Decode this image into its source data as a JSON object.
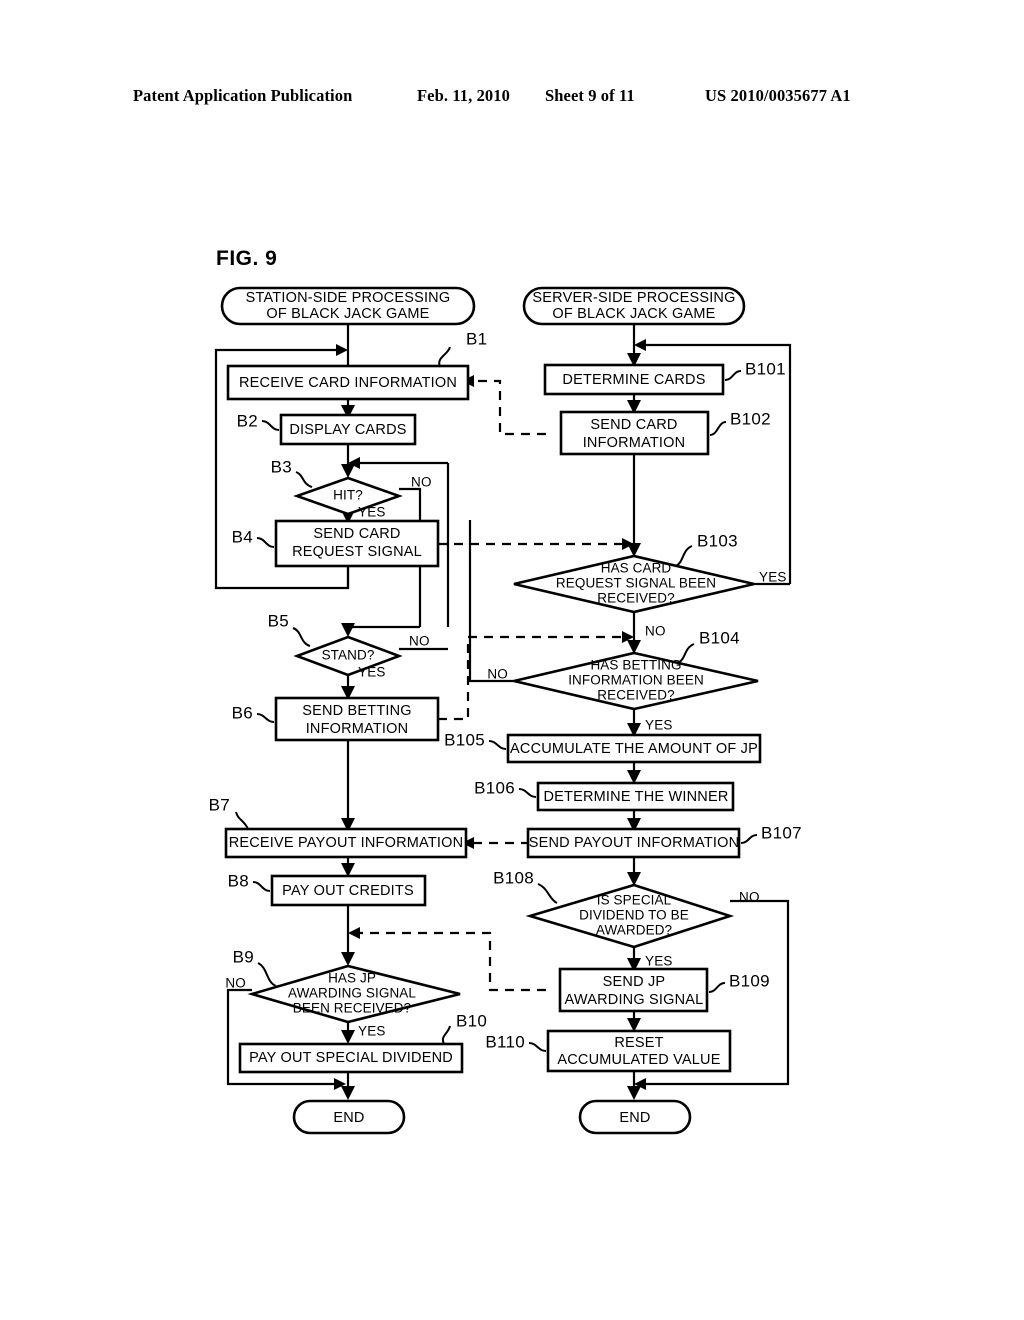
{
  "header": {
    "publication": "Patent Application Publication",
    "date": "Feb. 11, 2010",
    "sheet": "Sheet 9 of 11",
    "patent_number": "US 2010/0035677 A1"
  },
  "figure": {
    "label": "FIG. 9",
    "left_column_title": "STATION-SIDE PROCESSING OF BLACK JACK GAME",
    "right_column_title": "SERVER-SIDE PROCESSING OF BLACK JACK GAME"
  },
  "terminators": {
    "station_start_line1": "STATION-SIDE PROCESSING",
    "station_start_line2": "OF BLACK JACK GAME",
    "server_start_line1": "SERVER-SIDE PROCESSING",
    "server_start_line2": "OF BLACK JACK GAME",
    "end_left": "END",
    "end_right": "END"
  },
  "station_steps": [
    {
      "ref": "B1",
      "type": "process",
      "lines": [
        "RECEIVE CARD INFORMATION"
      ]
    },
    {
      "ref": "B2",
      "type": "process",
      "lines": [
        "DISPLAY CARDS"
      ]
    },
    {
      "ref": "B3",
      "type": "decision",
      "lines": [
        "HIT?"
      ],
      "yes": "YES",
      "no": "NO"
    },
    {
      "ref": "B4",
      "type": "process",
      "lines": [
        "SEND CARD",
        "REQUEST SIGNAL"
      ]
    },
    {
      "ref": "B5",
      "type": "decision",
      "lines": [
        "STAND?"
      ],
      "yes": "YES",
      "no": "NO"
    },
    {
      "ref": "B6",
      "type": "process",
      "lines": [
        "SEND BETTING",
        "INFORMATION"
      ]
    },
    {
      "ref": "B7",
      "type": "process",
      "lines": [
        "RECEIVE PAYOUT INFORMATION"
      ]
    },
    {
      "ref": "B8",
      "type": "process",
      "lines": [
        "PAY OUT CREDITS"
      ]
    },
    {
      "ref": "B9",
      "type": "decision",
      "lines": [
        "HAS JP",
        "AWARDING SIGNAL",
        "BEEN RECEIVED?"
      ],
      "yes": "YES",
      "no": "NO"
    },
    {
      "ref": "B10",
      "type": "process",
      "lines": [
        "PAY OUT SPECIAL DIVIDEND"
      ]
    }
  ],
  "server_steps": [
    {
      "ref": "B101",
      "type": "process",
      "lines": [
        "DETERMINE CARDS"
      ]
    },
    {
      "ref": "B102",
      "type": "process",
      "lines": [
        "SEND CARD",
        "INFORMATION"
      ]
    },
    {
      "ref": "B103",
      "type": "decision",
      "lines": [
        "HAS CARD",
        "REQUEST SIGNAL BEEN",
        "RECEIVED?"
      ],
      "yes": "YES",
      "no": "NO"
    },
    {
      "ref": "B104",
      "type": "decision",
      "lines": [
        "HAS BETTING",
        "INFORMATION BEEN",
        "RECEIVED?"
      ],
      "yes": "YES",
      "no": "NO"
    },
    {
      "ref": "B105",
      "type": "process",
      "lines": [
        "ACCUMULATE THE AMOUNT OF JP"
      ]
    },
    {
      "ref": "B106",
      "type": "process",
      "lines": [
        "DETERMINE THE WINNER"
      ]
    },
    {
      "ref": "B107",
      "type": "process",
      "lines": [
        "SEND PAYOUT INFORMATION"
      ]
    },
    {
      "ref": "B108",
      "type": "decision",
      "lines": [
        "IS SPECIAL",
        "DIVIDEND TO BE",
        "AWARDED?"
      ],
      "yes": "YES",
      "no": "NO"
    },
    {
      "ref": "B109",
      "type": "process",
      "lines": [
        "SEND JP",
        "AWARDING SIGNAL"
      ]
    },
    {
      "ref": "B110",
      "type": "process",
      "lines": [
        "RESET",
        "ACCUMULATED VALUE"
      ]
    }
  ],
  "branch_labels": {
    "b3_no": "NO",
    "b3_yes": "YES",
    "b5_no": "NO",
    "b5_yes": "YES",
    "b9_no": "NO",
    "b9_yes": "YES",
    "b103_yes": "YES",
    "b103_no": "NO",
    "b104_no": "NO",
    "b104_yes": "YES",
    "b108_no": "NO",
    "b108_yes": "YES"
  },
  "colors": {
    "ink": "#000000",
    "paper": "#ffffff"
  }
}
